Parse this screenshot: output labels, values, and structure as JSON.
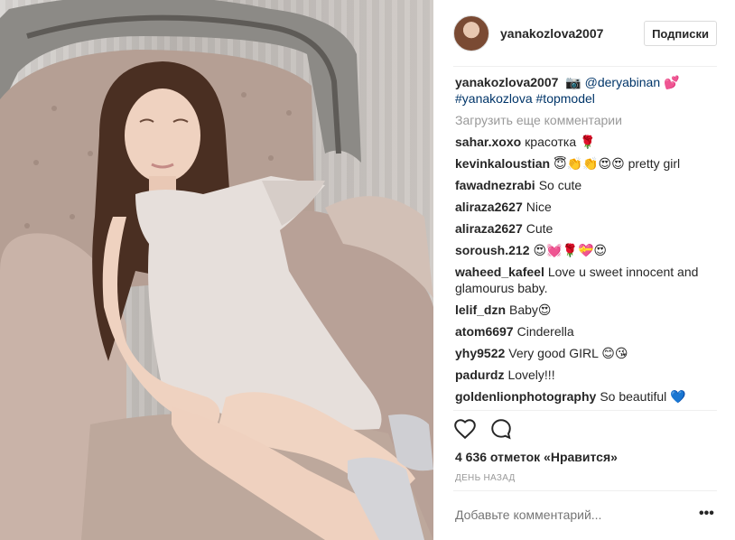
{
  "post": {
    "username": "yanakozlova2007",
    "follow_label": "Подписки",
    "caption": {
      "user": "yanakozlova2007",
      "camera_emoji": "📷",
      "mention": "@deryabinan",
      "mention_emoji": "💕",
      "hashtag1": "#yanakozlova",
      "hashtag2": "#topmodel"
    },
    "load_more": "Загрузить еще комментарии",
    "comments": [
      {
        "user": "sahar.xoxo",
        "text": "красотка 🌹"
      },
      {
        "user": "kevinkaloustian",
        "text": "😇👏👏😍😍  pretty girl"
      },
      {
        "user": "fawadnezrabi",
        "text": "So cute"
      },
      {
        "user": "aliraza2627",
        "text": "Nice"
      },
      {
        "user": "aliraza2627",
        "text": "Cute"
      },
      {
        "user": "soroush.212",
        "text": "😍💓🌹💝😍"
      },
      {
        "user": "waheed_kafeel",
        "text": "Love u sweet innocent and glamourus baby."
      },
      {
        "user": "lelif_dzn",
        "text": "Baby😍"
      },
      {
        "user": "atom6697",
        "text": "Cinderella"
      },
      {
        "user": "yhy9522",
        "text": "Very good GIRL 😊😘"
      },
      {
        "user": "padurdz",
        "text": "Lovely!!!"
      },
      {
        "user": "goldenlionphotography",
        "text": "So beautiful 💙"
      }
    ],
    "likes": "4 636 отметок «Нравится»",
    "time": "ДЕНЬ НАЗАД",
    "add_comment_placeholder": "Добавьте комментарий...",
    "more_options": "•••",
    "icons": {
      "like": "heart-icon",
      "comment": "comment-bubble-icon",
      "options": "more-dots-icon"
    }
  }
}
